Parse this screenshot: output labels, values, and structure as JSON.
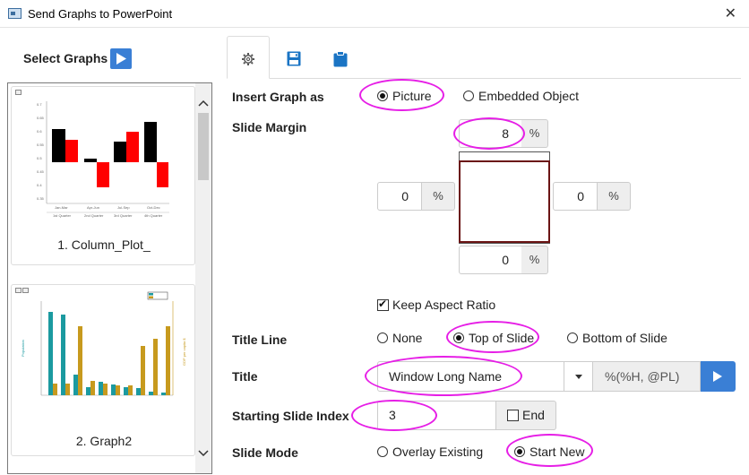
{
  "window": {
    "title": "Send Graphs to PowerPoint"
  },
  "left": {
    "select_label": "Select Graphs",
    "thumbnails": [
      {
        "caption": "1. Column_Plot_"
      },
      {
        "caption": "2. Graph2"
      }
    ]
  },
  "tabs": [
    {
      "icon": "gear-icon",
      "active": true
    },
    {
      "icon": "save-icon",
      "active": false
    },
    {
      "icon": "clipboard-icon",
      "active": false
    }
  ],
  "form": {
    "insert_label": "Insert Graph as",
    "insert_options": [
      "Picture",
      "Embedded Object"
    ],
    "insert_selected": "Picture",
    "margin_label": "Slide Margin",
    "margin_top": "8",
    "margin_left": "0",
    "margin_right": "0",
    "margin_bottom": "0",
    "percent": "%",
    "keep_aspect_label": "Keep Aspect Ratio",
    "keep_aspect_checked": true,
    "title_line_label": "Title Line",
    "title_line_options": [
      "None",
      "Top of Slide",
      "Bottom of Slide"
    ],
    "title_line_selected": "Top of Slide",
    "title_label": "Title",
    "title_value": "Window Long Name",
    "title_format": "%(%H, @PL)",
    "index_label": "Starting Slide Index",
    "index_value": "3",
    "end_label": "End",
    "end_checked": false,
    "mode_label": "Slide Mode",
    "mode_options": [
      "Overlay Existing",
      "Start New"
    ],
    "mode_selected": "Start New"
  },
  "colors": {
    "accent": "#3a7fd5",
    "highlight": "#e61ee6",
    "margin_frame": "#6b1414"
  }
}
